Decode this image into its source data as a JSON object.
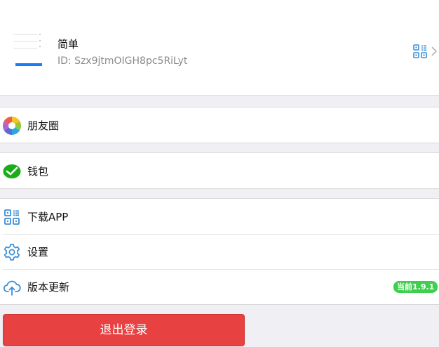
{
  "profile": {
    "name": "简单",
    "id_text": "ID: Szx9jtmOIGH8pc5RiLyt"
  },
  "menu": {
    "moments": {
      "label": "朋友圈",
      "icon": "moments-icon"
    },
    "wallet": {
      "label": "钱包",
      "icon": "wallet-icon"
    },
    "download": {
      "label": "下载APP",
      "icon": "qr-code-icon"
    },
    "settings": {
      "label": "设置",
      "icon": "gear-icon"
    },
    "update": {
      "label": "版本更新",
      "icon": "cloud-upload-icon",
      "badge": "当前1.9.1"
    }
  },
  "logout": {
    "label": "退出登录"
  },
  "colors": {
    "accent_blue": "#1c7cf4",
    "logout_red": "#e84141",
    "badge_green": "#3fcf4f",
    "wallet_green": "#1aad19",
    "background": "#efeff4"
  }
}
